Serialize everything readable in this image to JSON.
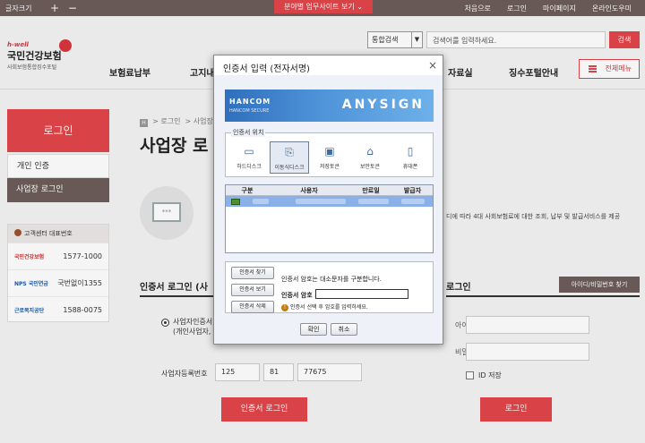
{
  "topbar": {
    "font_size_label": "글자크기",
    "zoom_in": "+",
    "zoom_out": "−",
    "center_button": "분야별 업무사이트 보기 ⌄",
    "links": [
      "처음으로",
      "로그인",
      "마이페이지",
      "온라인도우미"
    ]
  },
  "header": {
    "logo_hwell": "h-well",
    "logo_name": "국민건강보험",
    "logo_sub": "사회보험통합징수포털",
    "search_scope": "통합검색",
    "search_placeholder": "검색어를 입력하세요.",
    "search_button": "검색",
    "nav": [
      "보험료납부",
      "고지내",
      "자료실",
      "징수포털안내"
    ],
    "all_menu": "전체메뉴"
  },
  "sidebar": {
    "login_title": "로그인",
    "items": [
      "개인 인증",
      "사업장 로그인"
    ],
    "center_title": "고객센터 대표번호",
    "centers": [
      {
        "org": "국민건강보험",
        "phone": "1577-1000"
      },
      {
        "org": "NPS 국민연금",
        "phone": "국번없이1355"
      },
      {
        "org": "근로복지공단",
        "phone": "1588-0075"
      }
    ]
  },
  "main": {
    "breadcrumb_home": "H",
    "breadcrumb": [
      "로그인",
      "사업장 로"
    ],
    "title": "사업장 로",
    "illustration_text": "***",
    "description": "디에 따라 4대 사회보험료에 대한 조회, 납부 및 발급서비스를 제공",
    "cert_login_title": "인증서 로그인 (사",
    "id_login_title": "로그인",
    "id_pw_find": "아이디/비밀번호 찾기",
    "radio_label_1": "사업자인증서",
    "radio_label_2": "(개인사업자, 법",
    "reg_label": "사업자등록번호",
    "reg_values": [
      "125",
      "81",
      "77675"
    ],
    "cert_login_button": "인증서 로그인",
    "id_label": "아이디",
    "pw_label": "비밀번호",
    "save_id_label": "ID 저장",
    "login_button": "로그인"
  },
  "dialog": {
    "title": "인증서 입력 (전자서명)",
    "close": "×",
    "banner_brand": "HANCOM",
    "banner_brand_sub": "HANCOM SECURE",
    "banner_product": "ANYSIGN",
    "location_legend": "인증서 위치",
    "locations": [
      {
        "label": "하드디스크",
        "icon": "▭"
      },
      {
        "label": "이동식디스크",
        "icon": "⎘"
      },
      {
        "label": "저장토큰",
        "icon": "▣"
      },
      {
        "label": "보안토큰",
        "icon": "⌂"
      },
      {
        "label": "휴대폰",
        "icon": "▯"
      }
    ],
    "table_headers": [
      "구분",
      "사용자",
      "만료일",
      "발급자"
    ],
    "buttons": [
      "인증서 찾기",
      "인증서 보기",
      "인증서 삭제"
    ],
    "case_note": "인증서 암호는 대소문자를 구분합니다.",
    "password_label": "인증서 암호 :",
    "hint_icon": "!",
    "hint": "인증서 선택 후 암호를 입력하세요.",
    "ok": "확인",
    "cancel": "취소"
  }
}
